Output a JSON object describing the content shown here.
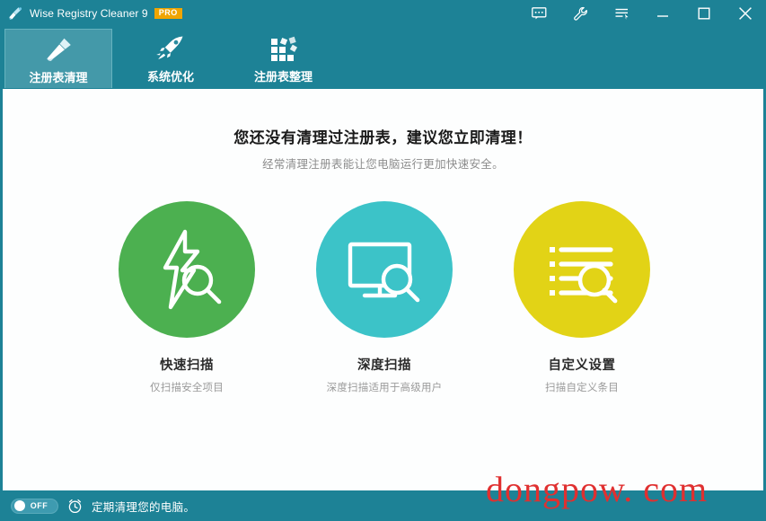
{
  "window": {
    "title": "Wise Registry Cleaner 9",
    "badge": "PRO",
    "app_icon": "broom-app-icon",
    "titlebar_color": "#1d8296",
    "controls": [
      {
        "name": "feedback-icon",
        "label": "Feedback"
      },
      {
        "name": "tools-icon",
        "label": "Tools"
      },
      {
        "name": "menu-icon",
        "label": "Menu"
      },
      {
        "name": "minimize-icon",
        "label": "Minimize"
      },
      {
        "name": "maximize-icon",
        "label": "Maximize"
      },
      {
        "name": "close-icon",
        "label": "Close"
      }
    ]
  },
  "tabs": [
    {
      "label": "注册表清理",
      "icon": "broom-icon",
      "active": true
    },
    {
      "label": "系统优化",
      "icon": "rocket-icon",
      "active": false
    },
    {
      "label": "注册表整理",
      "icon": "blocks-icon",
      "active": false
    }
  ],
  "main": {
    "headline": "您还没有清理过注册表，建议您立即清理！",
    "subline": "经常清理注册表能让您电脑运行更加快速安全。",
    "actions": [
      {
        "title": "快速扫描",
        "desc": "仅扫描安全项目",
        "icon": "lightning-search-icon",
        "color": "#4cb050"
      },
      {
        "title": "深度扫描",
        "desc": "深度扫描适用于高级用户",
        "icon": "monitor-search-icon",
        "color": "#3cc3c8"
      },
      {
        "title": "自定义设置",
        "desc": "扫描自定义条目",
        "icon": "list-search-icon",
        "color": "#e2d316"
      }
    ]
  },
  "statusbar": {
    "toggle_state": "OFF",
    "clock_icon": "alarm-clock-icon",
    "text": "定期清理您的电脑。"
  },
  "watermark": {
    "text": "dongpow. com",
    "color": "#e03030"
  }
}
